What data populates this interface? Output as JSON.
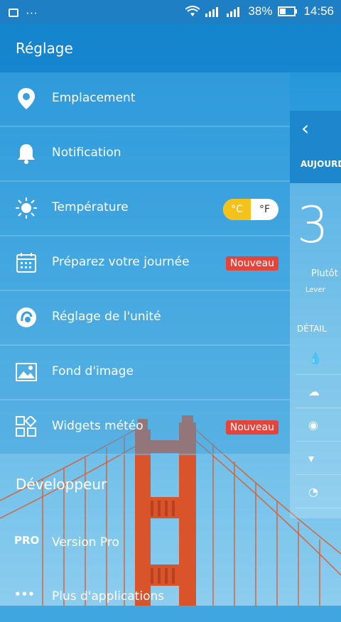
{
  "status": {
    "battery": "38%",
    "time": "14:56",
    "more": "···"
  },
  "header": {
    "title": "Réglage"
  },
  "items": [
    {
      "label": "Emplacement"
    },
    {
      "label": "Notification"
    },
    {
      "label": "Température",
      "toggle_c": "°C",
      "toggle_f": "°F"
    },
    {
      "label": "Préparez votre journée",
      "badge": "Nouveau"
    },
    {
      "label": "Réglage de l'unité"
    },
    {
      "label": "Fond d'image"
    },
    {
      "label": "Widgets météo",
      "badge": "Nouveau"
    }
  ],
  "developer": {
    "title": "Développeur",
    "items": [
      {
        "icon_text": "PRO",
        "label": "Version Pro"
      },
      {
        "icon_text": "•••",
        "label": "Plus d'applications"
      }
    ]
  },
  "panel": {
    "back": "‹",
    "tab": "AUJOURD",
    "temp": "3",
    "desc": "Plutôt",
    "lever": "Lever",
    "detail": "DÉTAIL"
  }
}
